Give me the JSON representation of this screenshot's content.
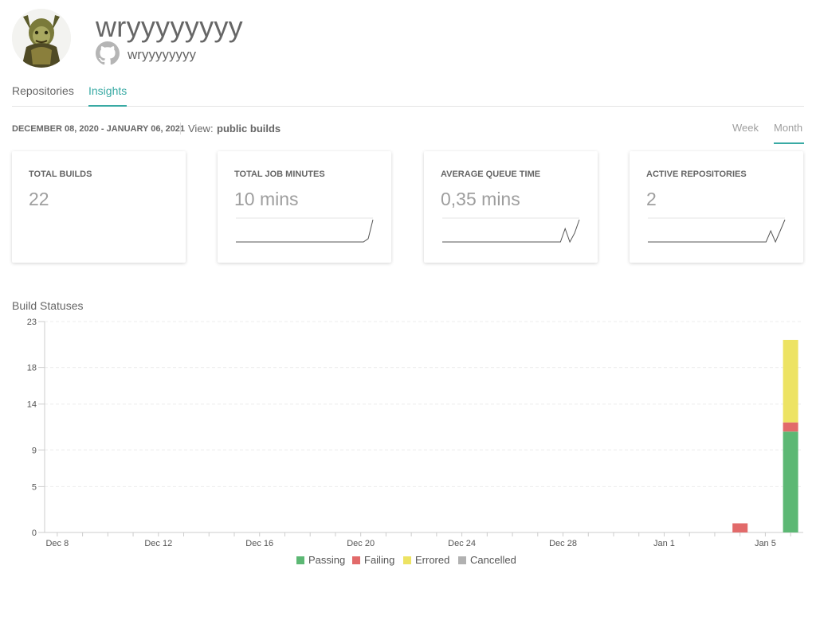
{
  "profile": {
    "name": "wryyyyyyyy",
    "login": "wryyyyyyyy",
    "avatar_icon": "avatar-image",
    "github_icon": "github-icon"
  },
  "tabs": [
    {
      "label": "Repositories",
      "active": false
    },
    {
      "label": "Insights",
      "active": true
    }
  ],
  "toolbar": {
    "date_range": "DECEMBER 08, 2020 - JANUARY 06, 2021",
    "view_label": "View:",
    "view_value": "public builds",
    "intervals": [
      {
        "label": "Week",
        "active": false
      },
      {
        "label": "Month",
        "active": true
      }
    ]
  },
  "cards": [
    {
      "title": "TOTAL BUILDS",
      "value": "22",
      "sparkline": null
    },
    {
      "title": "TOTAL JOB MINUTES",
      "value": "10 mins",
      "sparkline": [
        0,
        0,
        0,
        0,
        0,
        0,
        0,
        0,
        0,
        0,
        0,
        0,
        0,
        0,
        0,
        0,
        0,
        0,
        0,
        0,
        0,
        0,
        0,
        0,
        0,
        0,
        0,
        0,
        0.15,
        1
      ]
    },
    {
      "title": "AVERAGE QUEUE TIME",
      "value": "0,35 mins",
      "sparkline": [
        0,
        0,
        0,
        0,
        0,
        0,
        0,
        0,
        0,
        0,
        0,
        0,
        0,
        0,
        0,
        0,
        0,
        0,
        0,
        0,
        0,
        0,
        0,
        0,
        0,
        0,
        0.6,
        0,
        0.4,
        1
      ]
    },
    {
      "title": "ACTIVE REPOSITORIES",
      "value": "2",
      "sparkline": [
        0,
        0,
        0,
        0,
        0,
        0,
        0,
        0,
        0,
        0,
        0,
        0,
        0,
        0,
        0,
        0,
        0,
        0,
        0,
        0,
        0,
        0,
        0,
        0,
        0,
        0,
        0.5,
        0,
        0.5,
        1
      ]
    }
  ],
  "section_title": "Build Statuses",
  "colors": {
    "accent": "#39aaa4",
    "passing": "#5cb874",
    "failing": "#e26a6a",
    "errored": "#ede363",
    "cancelled": "#b1b1b1"
  },
  "chart_data": {
    "type": "bar",
    "stacked": true,
    "title": "Build Statuses",
    "xlabel": "",
    "ylabel": "",
    "ylim": [
      0,
      23
    ],
    "yticks": [
      0,
      5,
      9,
      14,
      18,
      23
    ],
    "categories": [
      "Dec 8",
      "Dec 9",
      "Dec 10",
      "Dec 11",
      "Dec 12",
      "Dec 13",
      "Dec 14",
      "Dec 15",
      "Dec 16",
      "Dec 17",
      "Dec 18",
      "Dec 19",
      "Dec 20",
      "Dec 21",
      "Dec 22",
      "Dec 23",
      "Dec 24",
      "Dec 25",
      "Dec 26",
      "Dec 27",
      "Dec 28",
      "Dec 29",
      "Dec 30",
      "Dec 31",
      "Jan 1",
      "Jan 2",
      "Jan 3",
      "Jan 4",
      "Jan 5",
      "Jan 6"
    ],
    "xtick_labels": [
      "Dec 8",
      "Dec 12",
      "Dec 16",
      "Dec 20",
      "Dec 24",
      "Dec 28",
      "Jan 1",
      "Jan 5"
    ],
    "series": [
      {
        "name": "Passing",
        "values": [
          0,
          0,
          0,
          0,
          0,
          0,
          0,
          0,
          0,
          0,
          0,
          0,
          0,
          0,
          0,
          0,
          0,
          0,
          0,
          0,
          0,
          0,
          0,
          0,
          0,
          0,
          0,
          0,
          0,
          11
        ]
      },
      {
        "name": "Failing",
        "values": [
          0,
          0,
          0,
          0,
          0,
          0,
          0,
          0,
          0,
          0,
          0,
          0,
          0,
          0,
          0,
          0,
          0,
          0,
          0,
          0,
          0,
          0,
          0,
          0,
          0,
          0,
          0,
          1,
          0,
          1
        ]
      },
      {
        "name": "Errored",
        "values": [
          0,
          0,
          0,
          0,
          0,
          0,
          0,
          0,
          0,
          0,
          0,
          0,
          0,
          0,
          0,
          0,
          0,
          0,
          0,
          0,
          0,
          0,
          0,
          0,
          0,
          0,
          0,
          0,
          0,
          9
        ]
      },
      {
        "name": "Cancelled",
        "values": [
          0,
          0,
          0,
          0,
          0,
          0,
          0,
          0,
          0,
          0,
          0,
          0,
          0,
          0,
          0,
          0,
          0,
          0,
          0,
          0,
          0,
          0,
          0,
          0,
          0,
          0,
          0,
          0,
          0,
          0
        ]
      }
    ],
    "grid": true,
    "legend": "bottom"
  }
}
